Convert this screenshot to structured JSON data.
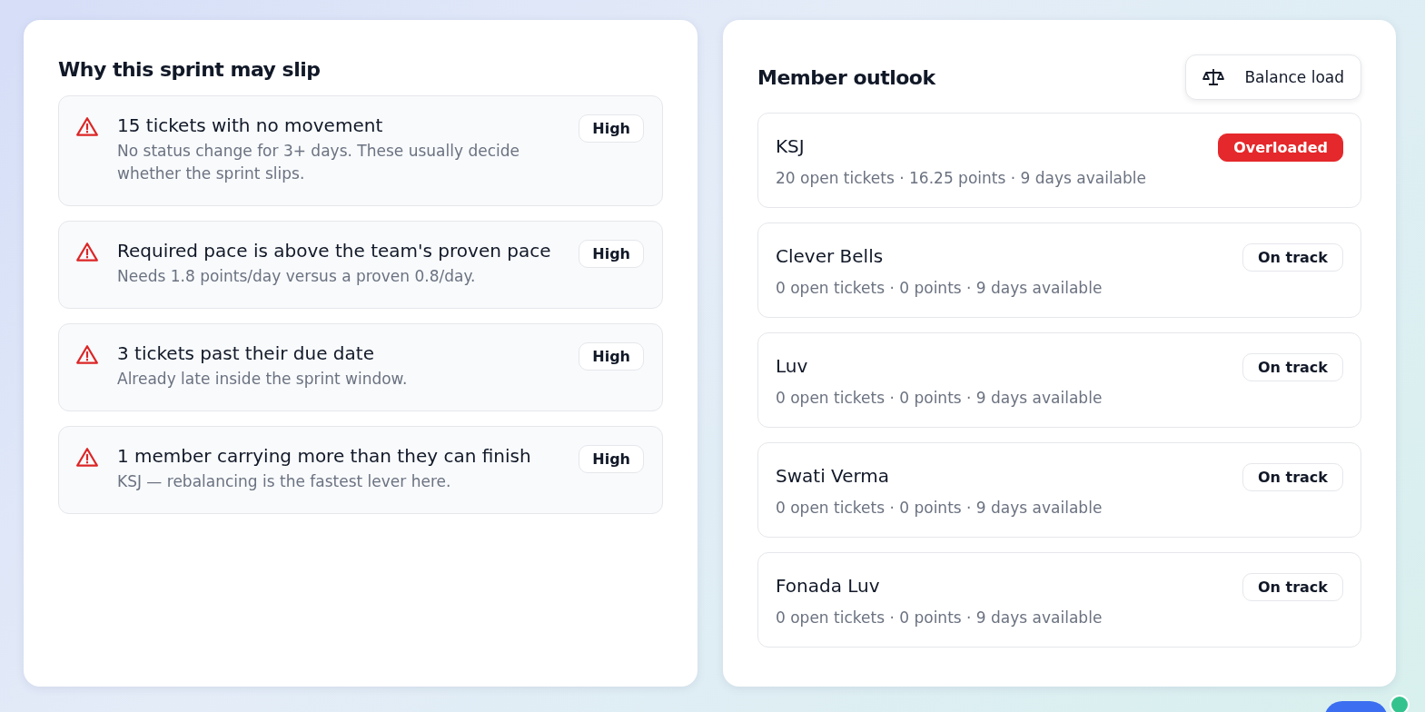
{
  "risks": {
    "title": "Why this sprint may slip",
    "items": [
      {
        "title": "15 tickets with no movement",
        "detail": "No status change for 3+ days. These usually decide whether the sprint slips.",
        "severity": "High"
      },
      {
        "title": "Required pace is above the team's proven pace",
        "detail": "Needs 1.8 points/day versus a proven 0.8/day.",
        "severity": "High"
      },
      {
        "title": "3 tickets past their due date",
        "detail": "Already late inside the sprint window.",
        "severity": "High"
      },
      {
        "title": "1 member carrying more than they can finish",
        "detail": "KSJ — rebalancing is the fastest lever here.",
        "severity": "High"
      }
    ]
  },
  "members": {
    "title": "Member outlook",
    "action": "Balance load",
    "items": [
      {
        "name": "KSJ",
        "summary": "20 open tickets · 16.25 points · 9 days available",
        "status": "Overloaded",
        "kind": "overloaded"
      },
      {
        "name": "Clever Bells",
        "summary": "0 open tickets · 0 points · 9 days available",
        "status": "On track",
        "kind": "on_track"
      },
      {
        "name": "Luv",
        "summary": "0 open tickets · 0 points · 9 days available",
        "status": "On track",
        "kind": "on_track"
      },
      {
        "name": "Swati Verma",
        "summary": "0 open tickets · 0 points · 9 days available",
        "status": "On track",
        "kind": "on_track"
      },
      {
        "name": "Fonada Luv",
        "summary": "0 open tickets · 0 points · 9 days available",
        "status": "On track",
        "kind": "on_track"
      }
    ]
  }
}
